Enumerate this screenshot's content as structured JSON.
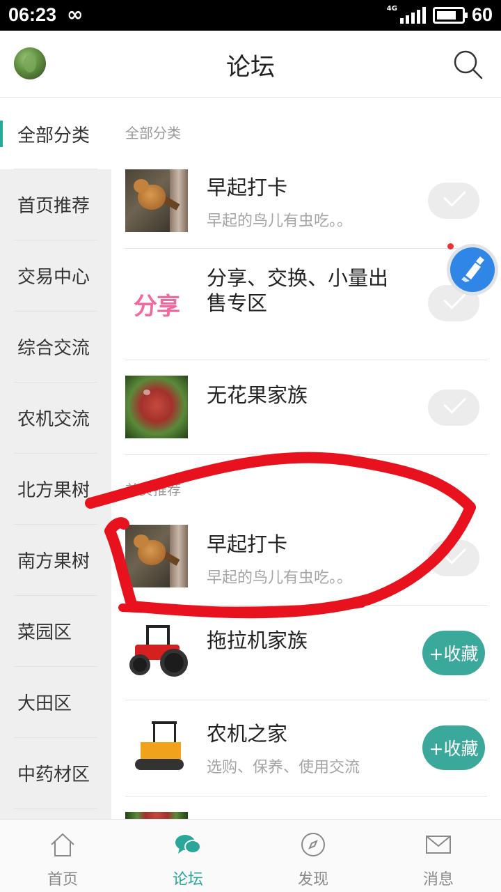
{
  "status_bar": {
    "time": "06:23",
    "network": "4G",
    "battery": "60"
  },
  "header": {
    "title": "论坛"
  },
  "sidebar": {
    "items": [
      {
        "label": "全部分类",
        "active": true
      },
      {
        "label": "首页推荐"
      },
      {
        "label": "交易中心"
      },
      {
        "label": "综合交流"
      },
      {
        "label": "农机交流"
      },
      {
        "label": "北方果树"
      },
      {
        "label": "南方果树"
      },
      {
        "label": "菜园区"
      },
      {
        "label": "大田区"
      },
      {
        "label": "中药材区"
      }
    ]
  },
  "content": {
    "section_all": "全部分类",
    "section_home": "首页推荐",
    "items": [
      {
        "title": "早起打卡",
        "subtitle": "早起的鸟儿有虫吃。。",
        "thumb": "bird",
        "state": "followed"
      },
      {
        "title_line1": "分享、交换、小量出",
        "title_line2": "售专区",
        "thumb": "share",
        "thumb_text": "分享",
        "state": "followed"
      },
      {
        "title": "无花果家族",
        "thumb": "fig",
        "state": "followed"
      },
      {
        "title": "早起打卡",
        "subtitle": "早起的鸟儿有虫吃。。",
        "thumb": "bird",
        "state": "followed"
      },
      {
        "title": "拖拉机家族",
        "thumb": "tractor",
        "state": "add",
        "button": "+收藏"
      },
      {
        "title": "农机之家",
        "subtitle": "选购、保养、使用交流",
        "thumb": "machine",
        "state": "add",
        "button": "+收藏"
      }
    ]
  },
  "bottom_nav": {
    "items": [
      {
        "label": "首页",
        "icon": "home-icon"
      },
      {
        "label": "论坛",
        "icon": "chat-bubbles-icon",
        "active": true
      },
      {
        "label": "发现",
        "icon": "compass-icon"
      },
      {
        "label": "消息",
        "icon": "envelope-icon"
      }
    ]
  },
  "colors": {
    "accent": "#2aa69a",
    "annotation": "#e8121e"
  }
}
